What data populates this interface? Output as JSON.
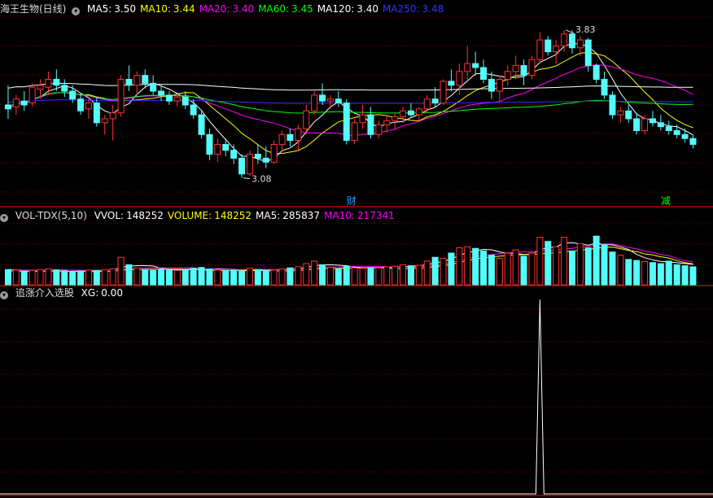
{
  "panels": {
    "price": {
      "title": "海王生物(日线)",
      "ma": [
        {
          "label": "MA5:",
          "value": "3.50",
          "color": "#ffffff"
        },
        {
          "label": "MA10:",
          "value": "3.44",
          "color": "#ffff00"
        },
        {
          "label": "MA20:",
          "value": "3.40",
          "color": "#ff00ff"
        },
        {
          "label": "MA60:",
          "value": "3.45",
          "color": "#00ff00"
        },
        {
          "label": "MA120:",
          "value": "3.40",
          "color": "#ffffff"
        },
        {
          "label": "MA250:",
          "value": "3.48",
          "color": "#3333ff"
        }
      ],
      "high_label": "3.83",
      "low_label": "3.08",
      "markers": [
        {
          "text": "财",
          "color": "#3399ff"
        },
        {
          "text": "减",
          "color": "#00ff00"
        }
      ]
    },
    "volume": {
      "title": "VOL-TDX(5,10)",
      "items": [
        {
          "label": "VVOL:",
          "value": "148252",
          "color": "#ffffff"
        },
        {
          "label": "VOLUME:",
          "value": "148252",
          "color": "#ffff00"
        },
        {
          "label": "MA5:",
          "value": "285837",
          "color": "#ffffff"
        },
        {
          "label": "MA10:",
          "value": "217341",
          "color": "#ff00ff"
        }
      ]
    },
    "indicator": {
      "title": "追涨介入选股",
      "items": [
        {
          "label": "XG:",
          "value": "0.00",
          "color": "#ffffff"
        }
      ]
    }
  },
  "colors": {
    "up": "#ff3333",
    "down": "#54fcfc",
    "grid": "#8b0000",
    "separator": "#b00000"
  },
  "chart_data": {
    "type": "candlestick",
    "price_range": [
      3.0,
      3.9
    ],
    "candles": [
      {
        "o": 3.45,
        "h": 3.55,
        "l": 3.38,
        "c": 3.43
      },
      {
        "o": 3.44,
        "h": 3.5,
        "l": 3.4,
        "c": 3.48
      },
      {
        "o": 3.47,
        "h": 3.52,
        "l": 3.42,
        "c": 3.45
      },
      {
        "o": 3.46,
        "h": 3.56,
        "l": 3.44,
        "c": 3.54
      },
      {
        "o": 3.53,
        "h": 3.58,
        "l": 3.48,
        "c": 3.55
      },
      {
        "o": 3.54,
        "h": 3.62,
        "l": 3.5,
        "c": 3.58
      },
      {
        "o": 3.58,
        "h": 3.63,
        "l": 3.52,
        "c": 3.55
      },
      {
        "o": 3.55,
        "h": 3.58,
        "l": 3.49,
        "c": 3.52
      },
      {
        "o": 3.52,
        "h": 3.55,
        "l": 3.46,
        "c": 3.48
      },
      {
        "o": 3.48,
        "h": 3.51,
        "l": 3.4,
        "c": 3.42
      },
      {
        "o": 3.43,
        "h": 3.48,
        "l": 3.38,
        "c": 3.46
      },
      {
        "o": 3.46,
        "h": 3.49,
        "l": 3.34,
        "c": 3.36
      },
      {
        "o": 3.36,
        "h": 3.4,
        "l": 3.3,
        "c": 3.38
      },
      {
        "o": 3.38,
        "h": 3.45,
        "l": 3.27,
        "c": 3.41
      },
      {
        "o": 3.41,
        "h": 3.6,
        "l": 3.39,
        "c": 3.58
      },
      {
        "o": 3.58,
        "h": 3.65,
        "l": 3.52,
        "c": 3.55
      },
      {
        "o": 3.55,
        "h": 3.62,
        "l": 3.5,
        "c": 3.6
      },
      {
        "o": 3.6,
        "h": 3.63,
        "l": 3.54,
        "c": 3.56
      },
      {
        "o": 3.56,
        "h": 3.6,
        "l": 3.5,
        "c": 3.52
      },
      {
        "o": 3.52,
        "h": 3.55,
        "l": 3.47,
        "c": 3.5
      },
      {
        "o": 3.5,
        "h": 3.52,
        "l": 3.45,
        "c": 3.47
      },
      {
        "o": 3.47,
        "h": 3.5,
        "l": 3.44,
        "c": 3.49
      },
      {
        "o": 3.49,
        "h": 3.52,
        "l": 3.43,
        "c": 3.45
      },
      {
        "o": 3.45,
        "h": 3.48,
        "l": 3.38,
        "c": 3.4
      },
      {
        "o": 3.4,
        "h": 3.42,
        "l": 3.28,
        "c": 3.3
      },
      {
        "o": 3.3,
        "h": 3.33,
        "l": 3.17,
        "c": 3.2
      },
      {
        "o": 3.2,
        "h": 3.28,
        "l": 3.16,
        "c": 3.25
      },
      {
        "o": 3.25,
        "h": 3.28,
        "l": 3.19,
        "c": 3.22
      },
      {
        "o": 3.22,
        "h": 3.25,
        "l": 3.15,
        "c": 3.18
      },
      {
        "o": 3.18,
        "h": 3.2,
        "l": 3.08,
        "c": 3.1
      },
      {
        "o": 3.1,
        "h": 3.22,
        "l": 3.09,
        "c": 3.2
      },
      {
        "o": 3.2,
        "h": 3.25,
        "l": 3.15,
        "c": 3.18
      },
      {
        "o": 3.18,
        "h": 3.24,
        "l": 3.13,
        "c": 3.16
      },
      {
        "o": 3.16,
        "h": 3.27,
        "l": 3.15,
        "c": 3.25
      },
      {
        "o": 3.25,
        "h": 3.32,
        "l": 3.21,
        "c": 3.3
      },
      {
        "o": 3.3,
        "h": 3.33,
        "l": 3.24,
        "c": 3.27
      },
      {
        "o": 3.27,
        "h": 3.35,
        "l": 3.22,
        "c": 3.33
      },
      {
        "o": 3.33,
        "h": 3.45,
        "l": 3.3,
        "c": 3.42
      },
      {
        "o": 3.42,
        "h": 3.52,
        "l": 3.4,
        "c": 3.5
      },
      {
        "o": 3.5,
        "h": 3.56,
        "l": 3.45,
        "c": 3.47
      },
      {
        "o": 3.47,
        "h": 3.5,
        "l": 3.43,
        "c": 3.48
      },
      {
        "o": 3.48,
        "h": 3.52,
        "l": 3.44,
        "c": 3.46
      },
      {
        "o": 3.46,
        "h": 3.48,
        "l": 3.25,
        "c": 3.27
      },
      {
        "o": 3.27,
        "h": 3.38,
        "l": 3.25,
        "c": 3.36
      },
      {
        "o": 3.36,
        "h": 3.45,
        "l": 3.33,
        "c": 3.4
      },
      {
        "o": 3.4,
        "h": 3.44,
        "l": 3.28,
        "c": 3.3
      },
      {
        "o": 3.3,
        "h": 3.37,
        "l": 3.28,
        "c": 3.35
      },
      {
        "o": 3.35,
        "h": 3.4,
        "l": 3.31,
        "c": 3.37
      },
      {
        "o": 3.37,
        "h": 3.41,
        "l": 3.32,
        "c": 3.39
      },
      {
        "o": 3.39,
        "h": 3.44,
        "l": 3.36,
        "c": 3.42
      },
      {
        "o": 3.42,
        "h": 3.46,
        "l": 3.39,
        "c": 3.4
      },
      {
        "o": 3.4,
        "h": 3.44,
        "l": 3.37,
        "c": 3.43
      },
      {
        "o": 3.43,
        "h": 3.5,
        "l": 3.41,
        "c": 3.48
      },
      {
        "o": 3.48,
        "h": 3.54,
        "l": 3.44,
        "c": 3.46
      },
      {
        "o": 3.46,
        "h": 3.58,
        "l": 3.45,
        "c": 3.57
      },
      {
        "o": 3.57,
        "h": 3.63,
        "l": 3.52,
        "c": 3.55
      },
      {
        "o": 3.55,
        "h": 3.66,
        "l": 3.5,
        "c": 3.62
      },
      {
        "o": 3.62,
        "h": 3.75,
        "l": 3.58,
        "c": 3.66
      },
      {
        "o": 3.66,
        "h": 3.72,
        "l": 3.6,
        "c": 3.64
      },
      {
        "o": 3.64,
        "h": 3.68,
        "l": 3.56,
        "c": 3.58
      },
      {
        "o": 3.58,
        "h": 3.62,
        "l": 3.48,
        "c": 3.52
      },
      {
        "o": 3.52,
        "h": 3.6,
        "l": 3.47,
        "c": 3.58
      },
      {
        "o": 3.58,
        "h": 3.65,
        "l": 3.55,
        "c": 3.62
      },
      {
        "o": 3.62,
        "h": 3.7,
        "l": 3.58,
        "c": 3.65
      },
      {
        "o": 3.65,
        "h": 3.68,
        "l": 3.55,
        "c": 3.6
      },
      {
        "o": 3.6,
        "h": 3.7,
        "l": 3.58,
        "c": 3.68
      },
      {
        "o": 3.68,
        "h": 3.82,
        "l": 3.66,
        "c": 3.78
      },
      {
        "o": 3.78,
        "h": 3.8,
        "l": 3.7,
        "c": 3.72
      },
      {
        "o": 3.72,
        "h": 3.78,
        "l": 3.66,
        "c": 3.75
      },
      {
        "o": 3.75,
        "h": 3.83,
        "l": 3.72,
        "c": 3.81
      },
      {
        "o": 3.81,
        "h": 3.83,
        "l": 3.71,
        "c": 3.74
      },
      {
        "o": 3.74,
        "h": 3.8,
        "l": 3.7,
        "c": 3.78
      },
      {
        "o": 3.78,
        "h": 3.79,
        "l": 3.62,
        "c": 3.65
      },
      {
        "o": 3.65,
        "h": 3.66,
        "l": 3.56,
        "c": 3.58
      },
      {
        "o": 3.58,
        "h": 3.62,
        "l": 3.48,
        "c": 3.5
      },
      {
        "o": 3.5,
        "h": 3.52,
        "l": 3.38,
        "c": 3.4
      },
      {
        "o": 3.4,
        "h": 3.44,
        "l": 3.36,
        "c": 3.42
      },
      {
        "o": 3.42,
        "h": 3.45,
        "l": 3.36,
        "c": 3.38
      },
      {
        "o": 3.38,
        "h": 3.41,
        "l": 3.3,
        "c": 3.32
      },
      {
        "o": 3.32,
        "h": 3.4,
        "l": 3.3,
        "c": 3.38
      },
      {
        "o": 3.38,
        "h": 3.42,
        "l": 3.34,
        "c": 3.36
      },
      {
        "o": 3.36,
        "h": 3.4,
        "l": 3.32,
        "c": 3.34
      },
      {
        "o": 3.34,
        "h": 3.37,
        "l": 3.3,
        "c": 3.32
      },
      {
        "o": 3.32,
        "h": 3.35,
        "l": 3.28,
        "c": 3.3
      },
      {
        "o": 3.3,
        "h": 3.33,
        "l": 3.26,
        "c": 3.28
      },
      {
        "o": 3.28,
        "h": 3.3,
        "l": 3.23,
        "c": 3.25
      }
    ],
    "volume_range": [
      0,
      300000
    ],
    "volumes": [
      72000,
      70000,
      65000,
      68000,
      72000,
      75000,
      70000,
      66000,
      62000,
      65000,
      70000,
      68000,
      72000,
      75000,
      130000,
      95000,
      80000,
      72000,
      68000,
      75000,
      70000,
      68000,
      72000,
      78000,
      82000,
      75000,
      70000,
      68000,
      70000,
      65000,
      78000,
      72000,
      68000,
      70000,
      75000,
      80000,
      85000,
      100000,
      112000,
      95000,
      82000,
      75000,
      88000,
      80000,
      78000,
      82000,
      80000,
      85000,
      88000,
      95000,
      90000,
      92000,
      112000,
      130000,
      125000,
      150000,
      175000,
      180000,
      172000,
      160000,
      140000,
      125000,
      150000,
      165000,
      135000,
      150000,
      225000,
      205000,
      180000,
      225000,
      160000,
      195000,
      175000,
      230000,
      190000,
      155000,
      140000,
      120000,
      115000,
      110000,
      105000,
      100000,
      112000,
      95000,
      90000,
      85000
    ],
    "indicator": {
      "label": "XG",
      "range": [
        0,
        1
      ],
      "signal_index": 66
    }
  }
}
